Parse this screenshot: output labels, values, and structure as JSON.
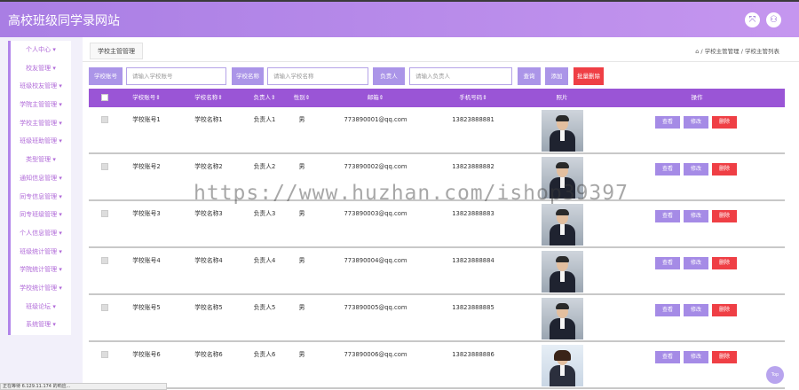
{
  "app": {
    "title": "高校班级同学录网站"
  },
  "header_icons": [
    "fullscreen-icon",
    "user-icon"
  ],
  "sidebar": {
    "items": [
      "个人中心",
      "校友管理",
      "班级校友管理",
      "学院主管管理",
      "学校主管管理",
      "班级班助管理",
      "类型管理",
      "通知信息管理",
      "同专信息管理",
      "同专班级管理",
      "个人信息管理",
      "班级统计管理",
      "学院统计管理",
      "学校统计管理",
      "班级论坛",
      "系统管理"
    ]
  },
  "tab": {
    "label": "学校主管管理"
  },
  "breadcrumb": {
    "path": "/ 学校主管管理 / 学校主管列表"
  },
  "search": {
    "account_label": "学校账号",
    "account_placeholder": "请输入学校账号",
    "name_label": "学校名称",
    "name_placeholder": "请输入学校名称",
    "head_label": "负责人",
    "head_placeholder": "请输入负责人",
    "query_button": "查询",
    "add_button": "添加",
    "batch_delete_button": "批量删除"
  },
  "table": {
    "headers": [
      "学校账号⇕",
      "学校名称⇕",
      "负责人⇕",
      "性别⇕",
      "邮箱⇕",
      "手机号码⇕",
      "照片",
      "操作"
    ],
    "rows": [
      {
        "account": "学校账号1",
        "name": "学校名称1",
        "head": "负责人1",
        "gender": "男",
        "email": "773890001@qq.com",
        "phone": "13823888881"
      },
      {
        "account": "学校账号2",
        "name": "学校名称2",
        "head": "负责人2",
        "gender": "男",
        "email": "773890002@qq.com",
        "phone": "13823888882"
      },
      {
        "account": "学校账号3",
        "name": "学校名称3",
        "head": "负责人3",
        "gender": "男",
        "email": "773890003@qq.com",
        "phone": "13823888883"
      },
      {
        "account": "学校账号4",
        "name": "学校名称4",
        "head": "负责人4",
        "gender": "男",
        "email": "773890004@qq.com",
        "phone": "13823888884"
      },
      {
        "account": "学校账号5",
        "name": "学校名称5",
        "head": "负责人5",
        "gender": "男",
        "email": "773890005@qq.com",
        "phone": "13823888885"
      },
      {
        "account": "学校账号6",
        "name": "学校名称6",
        "head": "负责人6",
        "gender": "男",
        "email": "773890006@qq.com",
        "phone": "13823888886"
      }
    ],
    "actions": {
      "view": "查看",
      "edit": "修改",
      "delete": "删除"
    }
  },
  "watermark": "https://www.huzhan.com/ishop39397",
  "status_bar": "正在等待 6.129.11.174 的响应...",
  "back_to_top": "Top"
}
